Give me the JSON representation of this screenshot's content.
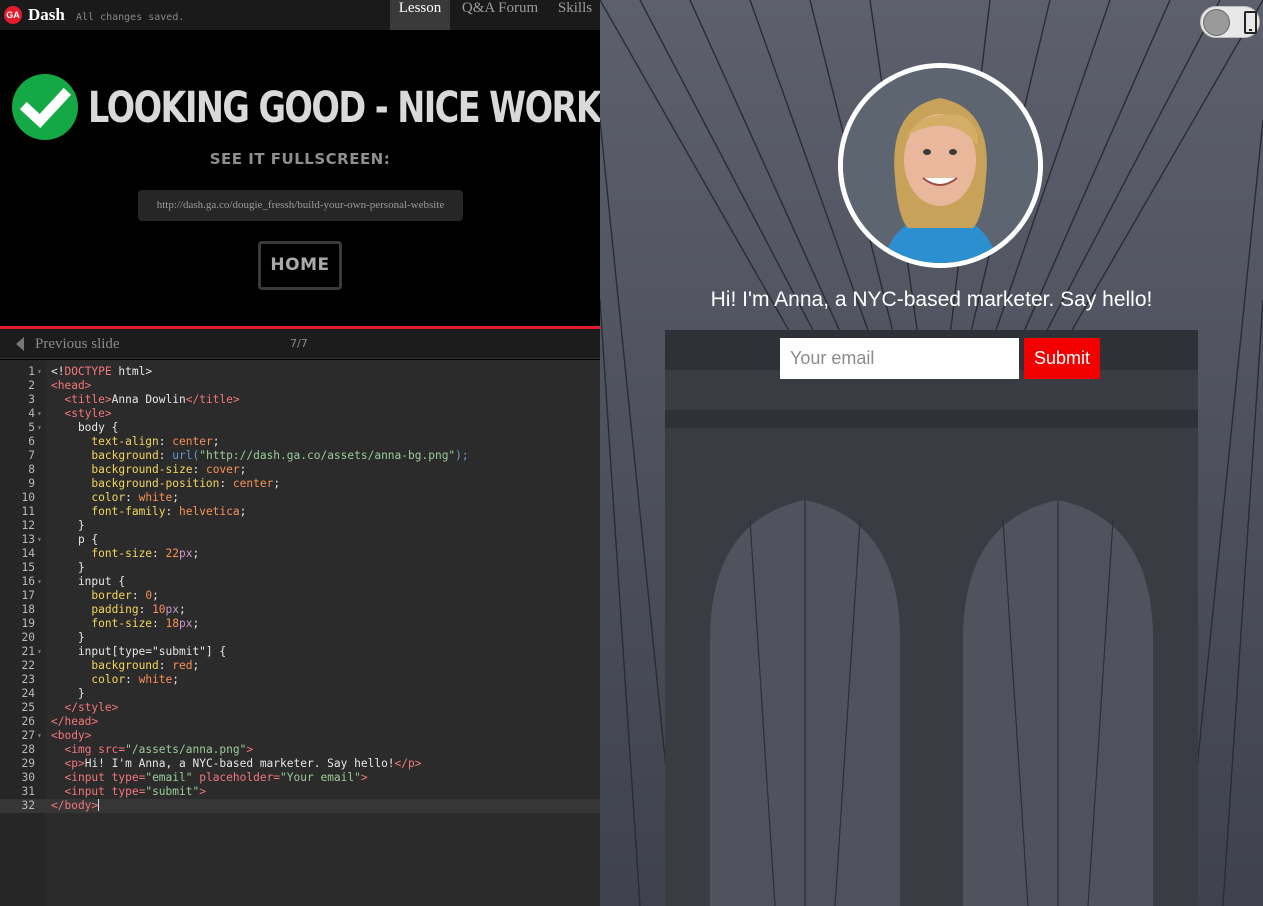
{
  "topbar": {
    "logo": "GA",
    "brand": "Dash",
    "status": "All changes saved.",
    "tabs": [
      "Lesson",
      "Q&A Forum",
      "Skills"
    ]
  },
  "lesson": {
    "headline": "LOOKING GOOD - NICE WORK!",
    "fullscreen_label": "SEE IT FULLSCREEN:",
    "url": "http://dash.ga.co/dougie_fressh/build-your-own-personal-website",
    "home_label": "HOME"
  },
  "slides": {
    "prev_label": "Previous slide",
    "counter": "7/7"
  },
  "code": {
    "active_line": 32,
    "lines": [
      [
        {
          "t": "<!",
          "c": "plain"
        },
        {
          "t": "DOCTYPE",
          "c": "tag"
        },
        {
          "t": " html>",
          "c": "plain"
        }
      ],
      [
        {
          "t": "<head>",
          "c": "tag"
        }
      ],
      [
        {
          "t": "  ",
          "c": "plain"
        },
        {
          "t": "<title>",
          "c": "tag"
        },
        {
          "t": "Anna Dowlin",
          "c": "plain"
        },
        {
          "t": "</title>",
          "c": "tag"
        }
      ],
      [
        {
          "t": "  ",
          "c": "plain"
        },
        {
          "t": "<style>",
          "c": "tag"
        }
      ],
      [
        {
          "t": "    body {",
          "c": "plain"
        }
      ],
      [
        {
          "t": "      ",
          "c": "plain"
        },
        {
          "t": "text-align",
          "c": "prop"
        },
        {
          "t": ": ",
          "c": "plain"
        },
        {
          "t": "center",
          "c": "val"
        },
        {
          "t": ";",
          "c": "plain"
        }
      ],
      [
        {
          "t": "      ",
          "c": "plain"
        },
        {
          "t": "background",
          "c": "prop"
        },
        {
          "t": ": ",
          "c": "plain"
        },
        {
          "t": "url(",
          "c": "fn"
        },
        {
          "t": "\"http://dash.ga.co/assets/anna-bg.png\"",
          "c": "str"
        },
        {
          "t": ");",
          "c": "fn"
        }
      ],
      [
        {
          "t": "      ",
          "c": "plain"
        },
        {
          "t": "background-size",
          "c": "prop"
        },
        {
          "t": ": ",
          "c": "plain"
        },
        {
          "t": "cover",
          "c": "val"
        },
        {
          "t": ";",
          "c": "plain"
        }
      ],
      [
        {
          "t": "      ",
          "c": "plain"
        },
        {
          "t": "background-position",
          "c": "prop"
        },
        {
          "t": ": ",
          "c": "plain"
        },
        {
          "t": "center",
          "c": "val"
        },
        {
          "t": ";",
          "c": "plain"
        }
      ],
      [
        {
          "t": "      ",
          "c": "plain"
        },
        {
          "t": "color",
          "c": "prop"
        },
        {
          "t": ": ",
          "c": "plain"
        },
        {
          "t": "white",
          "c": "val"
        },
        {
          "t": ";",
          "c": "plain"
        }
      ],
      [
        {
          "t": "      ",
          "c": "plain"
        },
        {
          "t": "font-family",
          "c": "prop"
        },
        {
          "t": ": ",
          "c": "plain"
        },
        {
          "t": "helvetica",
          "c": "val"
        },
        {
          "t": ";",
          "c": "plain"
        }
      ],
      [
        {
          "t": "    }",
          "c": "plain"
        }
      ],
      [
        {
          "t": "    p {",
          "c": "plain"
        }
      ],
      [
        {
          "t": "      ",
          "c": "plain"
        },
        {
          "t": "font-size",
          "c": "prop"
        },
        {
          "t": ": ",
          "c": "plain"
        },
        {
          "t": "22",
          "c": "num"
        },
        {
          "t": "px",
          "c": "unit"
        },
        {
          "t": ";",
          "c": "plain"
        }
      ],
      [
        {
          "t": "    }",
          "c": "plain"
        }
      ],
      [
        {
          "t": "    input {",
          "c": "plain"
        }
      ],
      [
        {
          "t": "      ",
          "c": "plain"
        },
        {
          "t": "border",
          "c": "prop"
        },
        {
          "t": ": ",
          "c": "plain"
        },
        {
          "t": "0",
          "c": "num"
        },
        {
          "t": ";",
          "c": "plain"
        }
      ],
      [
        {
          "t": "      ",
          "c": "plain"
        },
        {
          "t": "padding",
          "c": "prop"
        },
        {
          "t": ": ",
          "c": "plain"
        },
        {
          "t": "10",
          "c": "num"
        },
        {
          "t": "px",
          "c": "unit"
        },
        {
          "t": ";",
          "c": "plain"
        }
      ],
      [
        {
          "t": "      ",
          "c": "plain"
        },
        {
          "t": "font-size",
          "c": "prop"
        },
        {
          "t": ": ",
          "c": "plain"
        },
        {
          "t": "18",
          "c": "num"
        },
        {
          "t": "px",
          "c": "unit"
        },
        {
          "t": ";",
          "c": "plain"
        }
      ],
      [
        {
          "t": "    }",
          "c": "plain"
        }
      ],
      [
        {
          "t": "    input[type=\"submit\"] {",
          "c": "plain"
        }
      ],
      [
        {
          "t": "      ",
          "c": "plain"
        },
        {
          "t": "background",
          "c": "prop"
        },
        {
          "t": ": ",
          "c": "plain"
        },
        {
          "t": "red",
          "c": "val"
        },
        {
          "t": ";",
          "c": "plain"
        }
      ],
      [
        {
          "t": "      ",
          "c": "plain"
        },
        {
          "t": "color",
          "c": "prop"
        },
        {
          "t": ": ",
          "c": "plain"
        },
        {
          "t": "white",
          "c": "val"
        },
        {
          "t": ";",
          "c": "plain"
        }
      ],
      [
        {
          "t": "    }",
          "c": "plain"
        }
      ],
      [
        {
          "t": "  ",
          "c": "plain"
        },
        {
          "t": "</style>",
          "c": "tag"
        }
      ],
      [
        {
          "t": "</head>",
          "c": "tag"
        }
      ],
      [
        {
          "t": "<body>",
          "c": "tag"
        }
      ],
      [
        {
          "t": "  ",
          "c": "plain"
        },
        {
          "t": "<img ",
          "c": "tag"
        },
        {
          "t": "src=",
          "c": "tag"
        },
        {
          "t": "\"/assets/anna.png\"",
          "c": "str"
        },
        {
          "t": ">",
          "c": "tag"
        }
      ],
      [
        {
          "t": "  ",
          "c": "plain"
        },
        {
          "t": "<p>",
          "c": "tag"
        },
        {
          "t": "Hi! I'm Anna, a NYC-based marketer. Say hello!",
          "c": "plain"
        },
        {
          "t": "</p>",
          "c": "tag"
        }
      ],
      [
        {
          "t": "  ",
          "c": "plain"
        },
        {
          "t": "<input ",
          "c": "tag"
        },
        {
          "t": "type=",
          "c": "tag"
        },
        {
          "t": "\"email\"",
          "c": "str"
        },
        {
          "t": " placeholder=",
          "c": "tag"
        },
        {
          "t": "\"Your email\"",
          "c": "str"
        },
        {
          "t": ">",
          "c": "tag"
        }
      ],
      [
        {
          "t": "  ",
          "c": "plain"
        },
        {
          "t": "<input ",
          "c": "tag"
        },
        {
          "t": "type=",
          "c": "tag"
        },
        {
          "t": "\"submit\"",
          "c": "str"
        },
        {
          "t": ">",
          "c": "tag"
        }
      ],
      [
        {
          "t": "</body>",
          "c": "tag"
        }
      ]
    ],
    "foldable": [
      1,
      4,
      5,
      13,
      16,
      21,
      27
    ]
  },
  "preview": {
    "tagline": "Hi! I'm Anna, a NYC-based marketer. Say hello!",
    "email_placeholder": "Your email",
    "submit_label": "Submit"
  },
  "colors": {
    "accent_red": "#e41b2c",
    "success_green": "#15a945",
    "submit_red": "#f20000"
  },
  "icons": {
    "success": "checkmark-circle-icon",
    "prev": "caret-left-icon",
    "device": "mobile-phone-icon"
  }
}
